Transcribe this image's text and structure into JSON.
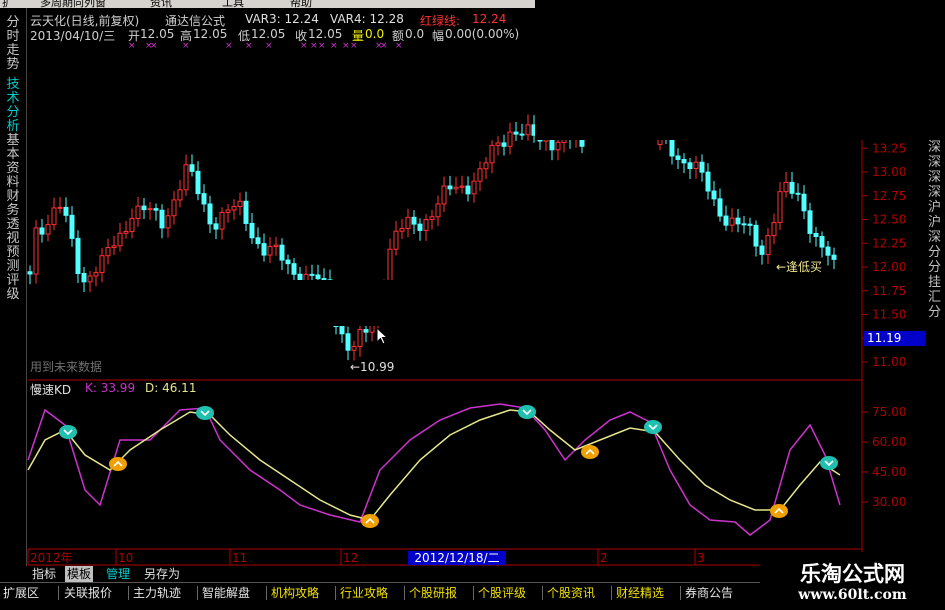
{
  "menubar": {
    "items": [
      "扩",
      "多周期同列窗",
      "资讯",
      "工具",
      "帮助"
    ]
  },
  "left_tabs": [
    {
      "label": "分时走势",
      "active": false
    },
    {
      "label": "技术分析",
      "active": true
    },
    {
      "label": "基本资料",
      "active": false
    },
    {
      "label": "财务透视",
      "active": false
    },
    {
      "label": "预测评级",
      "active": false
    }
  ],
  "header": {
    "stock": "云天化(日线,前复权)",
    "formula": "通达信公式",
    "var3": "VAR3: 12.24",
    "var4": "VAR4: 12.28",
    "line_label": "红绿线:",
    "line_value": "12.24",
    "date": "2013/04/10/三",
    "open_label": "开",
    "open": "12.05",
    "high_label": "高",
    "high": "12.05",
    "low_label": "低",
    "low": "12.05",
    "close_label": "收",
    "close": "12.05",
    "vol_label": "量",
    "vol": "0.0",
    "amt_label": "额",
    "amt": "0.0",
    "pct_label": "幅",
    "pct": "0.00(0.00%)"
  },
  "price_axis": [
    "13.25",
    "13.00",
    "12.75",
    "12.50",
    "12.25",
    "12.00",
    "11.75",
    "11.50",
    "11.25",
    "11.00"
  ],
  "current_price": "11.19",
  "annotations": {
    "low_label": "←10.99",
    "future_note": "用到未来数据",
    "buy_label": "←逢低买"
  },
  "right_edge_text": "深深深深沪沪深分分挂汇分",
  "indicator": {
    "name": "慢速KD",
    "k_label": "K: 33.99",
    "d_label": "D: 46.11",
    "axis": [
      "75.00",
      "60.00",
      "45.00",
      "30.00"
    ]
  },
  "date_axis": {
    "labels": [
      "2012年",
      "10",
      "11",
      "12",
      "2",
      "3"
    ],
    "cursor_date": "2012/12/18/二"
  },
  "bottom_tabs": [
    {
      "label": "指标",
      "active": false
    },
    {
      "label": "模板",
      "active": true
    },
    {
      "label": "管理",
      "active": false
    },
    {
      "label": "另存为",
      "active": false
    }
  ],
  "bottom_nav": [
    "扩展区",
    "关联报价",
    "主力轨迹",
    "智能解盘",
    "机构攻略",
    "行业攻略",
    "个股研报",
    "个股评级",
    "个股资讯",
    "财经精选",
    "券商公告"
  ],
  "logo": {
    "title": "乐淘公式网",
    "url": "www.60lt.com"
  },
  "colors": {
    "up": "#ff3232",
    "down": "#54ffff",
    "k_line": "#cc33cc",
    "d_line": "#e6e68c",
    "axis_red": "#b00000",
    "marker_buy": "#f0a000",
    "marker_sell": "#20c0b0",
    "accent_cyan": "#00cccc"
  }
}
